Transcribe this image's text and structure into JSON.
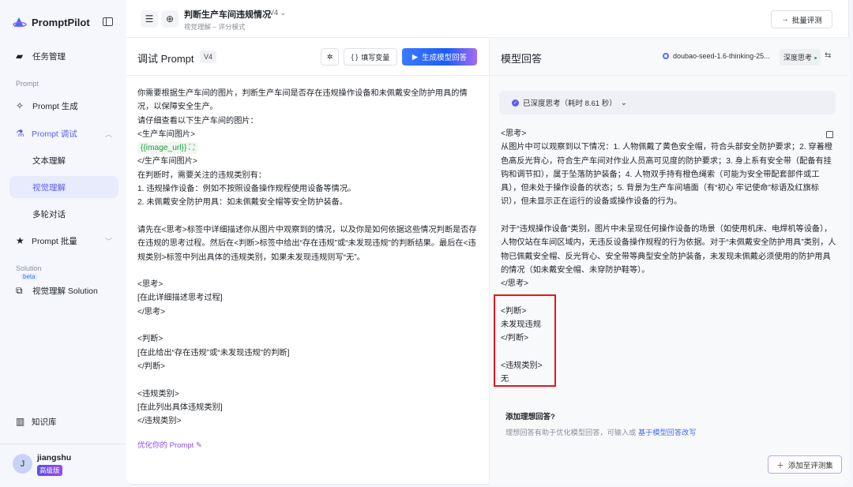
{
  "sidebar": {
    "brand": "PromptPilot",
    "task_mgmt": "任务管理",
    "section_prompt": "Prompt",
    "prompt_gen": "Prompt 生成",
    "prompt_debug": "Prompt 调试",
    "sub_text": "文本理解",
    "sub_vision": "视觉理解",
    "sub_multiturn": "多轮对话",
    "prompt_batch": "Prompt 批量",
    "section_solution": "Solution",
    "beta": "beta",
    "vision_solution": "视觉理解 Solution",
    "kb": "知识库",
    "user": {
      "initial": "J",
      "name": "jiangshu",
      "plan": "高级版"
    }
  },
  "header": {
    "title": "判断生产车间违规情况",
    "version": "V4",
    "subtitle": "视觉理解 – 评分模式",
    "batch_button": "批量评测"
  },
  "left_panel": {
    "title": "调试 Prompt",
    "version": "V4",
    "fill_vars": "填写变量",
    "generate": "生成模型回答",
    "prompt_before": "你需要根据生产车间的图片，判断生产车间是否存在违规操作设备和未佩戴安全防护用具的情况，以保障安全生产。\n请仔细查看以下生产车间的图片：\n<生产车间图片>\n",
    "variable": "{{image_url}}",
    "prompt_after": "\n</生产车间图片>\n在判断时，需要关注的违规类别有：\n1. 违规操作设备：例如不按照设备操作规程使用设备等情况。\n2. 未佩戴安全防护用具：如未佩戴安全帽等安全防护装备。\n\n请先在<思考>标签中详细描述你从图片中观察到的情况，以及你是如何依据这些情况判断是否存在违规的思考过程。然后在<判断>标签中给出“存在违规”或“未发现违规”的判断结果。最后在<违规类别>标签中列出具体的违规类别，如果未发现违规则写“无”。\n\n<思考>\n[在此详细描述思考过程]\n</思考>\n\n<判断>\n[在此给出“存在违规”或“未发现违规”的判断]\n</判断>\n\n<违规类别>\n[在此列出具体违规类别]\n</违规类别>",
    "optimize": "优化你的 Prompt"
  },
  "right_panel": {
    "title": "模型回答",
    "model": "doubao-seed-1.6-thinking-25...",
    "deep_think": "深度思考",
    "thinking_status": "已深度思考（耗时 8.61 秒）",
    "answer": "<思考>\n从图片中可以观察到以下情况：1. 人物佩戴了黄色安全帽，符合头部安全防护要求；2. 穿着橙色高反光背心，符合生产车间对作业人员高可见度的防护要求；3. 身上系有安全带（配备有挂钩和调节扣），属于坠落防护装备；4. 人物双手持有橙色绳索（可能为安全带配套部件或工具），但未处于操作设备的状态；5. 背景为生产车间墙面（有“初心 牢记使命”标语及红旗标识），但未显示正在运行的设备或操作设备的行为。\n\n对于“违规操作设备”类别，图片中未呈现任何操作设备的场景（如使用机床、电焊机等设备），人物仅站在车间区域内，无违反设备操作规程的行为依据。对于“未佩戴安全防护用具”类别，人物已佩戴安全帽、反光背心、安全带等典型安全防护装备，未发现未佩戴必须使用的防护用具的情况（如未戴安全帽、未穿防护鞋等）。\n</思考>\n\n<判断>\n未发现违规\n</判断>\n\n<违规类别>\n无",
    "ideal_title": "添加理想回答?",
    "ideal_desc": "理想回答有助于优化模型回答，可输入或 ",
    "ideal_link": "基于模型回答改写",
    "add_to_eval": "添加至评测集"
  },
  "colors": {
    "accent": "#5b5ef0",
    "highlight_box": "#e8141c",
    "link": "#3b6cf6"
  }
}
